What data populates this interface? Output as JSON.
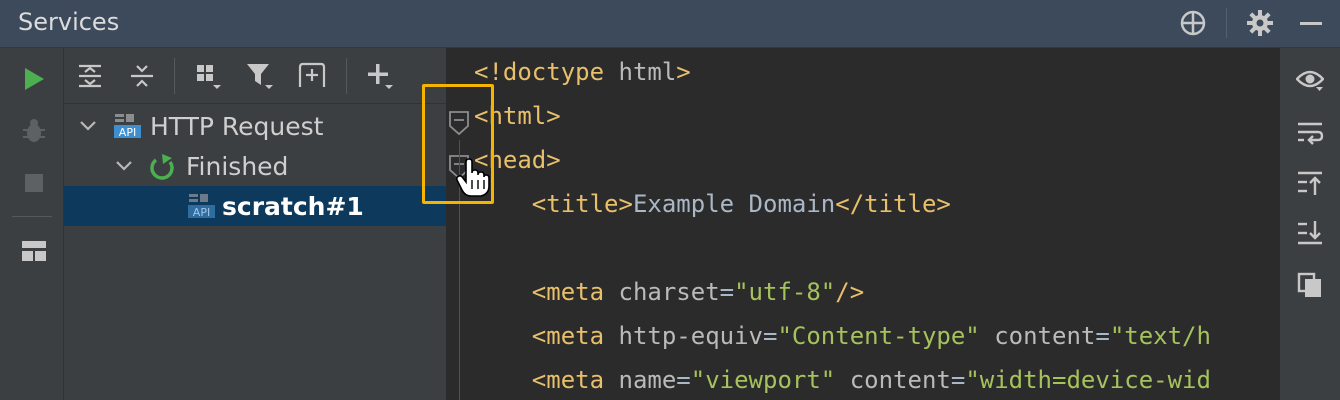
{
  "window": {
    "title": "Services"
  },
  "titlebar_icons": [
    "crosshair-icon",
    "gear-icon",
    "minimize-icon"
  ],
  "left_toolbar_icons": [
    "run-icon",
    "debug-icon",
    "stop-icon",
    "layout-icon"
  ],
  "tree_toolbar_icons": [
    "expand-all-icon",
    "collapse-all-icon",
    "group-by-icon",
    "filter-icon",
    "new-tab-icon",
    "add-service-icon"
  ],
  "tree": {
    "items": [
      {
        "label": "HTTP Request",
        "icon": "api-icon",
        "expanded": true,
        "depth": 0
      },
      {
        "label": "Finished",
        "icon": "rerun-icon",
        "expanded": true,
        "depth": 1
      },
      {
        "label": "scratch#1",
        "icon": "api-icon",
        "selected": true,
        "depth": 2
      }
    ]
  },
  "editor": {
    "lines": [
      [
        {
          "t": "tag",
          "s": "<!doctype "
        },
        {
          "t": "attr",
          "s": "html"
        },
        {
          "t": "tag",
          "s": ">"
        }
      ],
      [
        {
          "t": "tag",
          "s": "<html>"
        }
      ],
      [
        {
          "t": "tag",
          "s": "<head>"
        }
      ],
      [
        {
          "t": "txt",
          "s": "    "
        },
        {
          "t": "tag",
          "s": "<title>"
        },
        {
          "t": "txt",
          "s": "Example Domain"
        },
        {
          "t": "tag",
          "s": "</title>"
        }
      ],
      [],
      [
        {
          "t": "txt",
          "s": "    "
        },
        {
          "t": "tag",
          "s": "<meta "
        },
        {
          "t": "attr",
          "s": "charset"
        },
        {
          "t": "txt",
          "s": "="
        },
        {
          "t": "val",
          "s": "\"utf-8\""
        },
        {
          "t": "tag",
          "s": "/>"
        }
      ],
      [
        {
          "t": "txt",
          "s": "    "
        },
        {
          "t": "tag",
          "s": "<meta "
        },
        {
          "t": "attr",
          "s": "http-equiv"
        },
        {
          "t": "txt",
          "s": "="
        },
        {
          "t": "val",
          "s": "\"Content-type\""
        },
        {
          "t": "txt",
          "s": " "
        },
        {
          "t": "attr",
          "s": "content"
        },
        {
          "t": "txt",
          "s": "="
        },
        {
          "t": "val",
          "s": "\"text/h"
        }
      ],
      [
        {
          "t": "txt",
          "s": "    "
        },
        {
          "t": "tag",
          "s": "<meta "
        },
        {
          "t": "attr",
          "s": "name"
        },
        {
          "t": "txt",
          "s": "="
        },
        {
          "t": "val",
          "s": "\"viewport\""
        },
        {
          "t": "txt",
          "s": " "
        },
        {
          "t": "attr",
          "s": "content"
        },
        {
          "t": "txt",
          "s": "="
        },
        {
          "t": "val",
          "s": "\"width=device-wid"
        }
      ]
    ]
  },
  "right_toolbar_icons": [
    "preview-eye-icon",
    "soft-wrap-icon",
    "scroll-to-top-icon",
    "scroll-to-end-icon",
    "copy-icon"
  ],
  "colors": {
    "accent_highlight": "#f4b400",
    "selection": "#0d3a5c",
    "run_green": "#4caf50",
    "api_blue": "#3d8fd1"
  }
}
